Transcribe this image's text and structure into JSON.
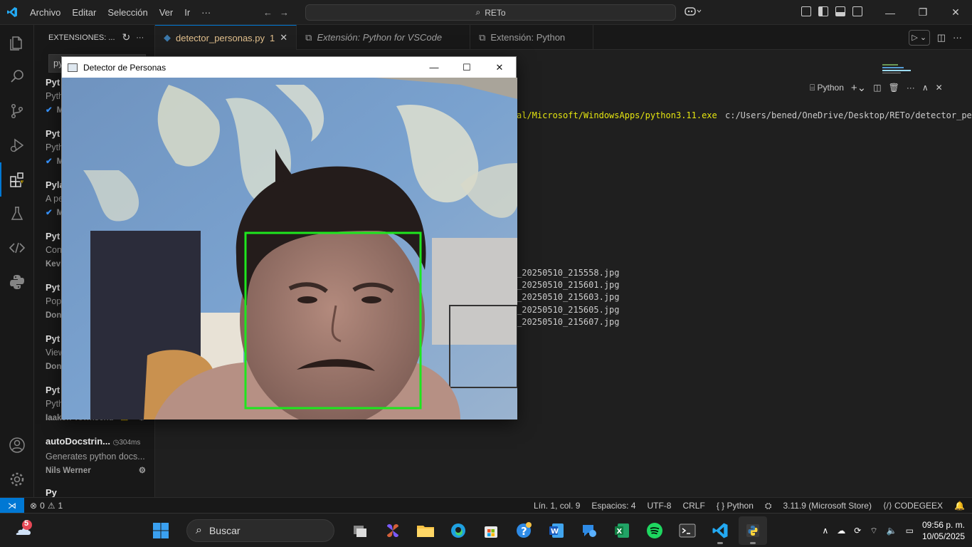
{
  "titlebar": {
    "menu": [
      "Archivo",
      "Editar",
      "Selección",
      "Ver",
      "Ir",
      "···"
    ],
    "search": "RETo"
  },
  "sidebar": {
    "title": "EXTENSIONES: ...",
    "search_value": "py",
    "extensions": [
      {
        "name": "Pyt",
        "desc": "Pyth",
        "publisher": "M"
      },
      {
        "name": "Pyt",
        "desc": "Pyth",
        "publisher": "M"
      },
      {
        "name": "Pyla",
        "desc": "A pe",
        "publisher": "M"
      },
      {
        "name": "Pyt",
        "desc": "Con",
        "publisher": "Kevi"
      },
      {
        "name": "Pyt",
        "desc": "Pop",
        "publisher": "Don"
      },
      {
        "name": "Pyt",
        "desc": "View",
        "publisher": "Don"
      },
      {
        "name": "Pyt",
        "desc": "Pyth",
        "publisher": "Iaakon Townsend"
      },
      {
        "name": "autoDocstrin...",
        "desc": "Generates python docs...",
        "publisher": "Nils Werner",
        "time": "304ms"
      },
      {
        "name": "Py",
        "desc": "",
        "publisher": ""
      }
    ]
  },
  "tabs": [
    {
      "label": "detector_personas.py",
      "badge": "1",
      "active": true
    },
    {
      "label": "Extensión: Python for VSCode",
      "active": false
    },
    {
      "label": "Extensión: Python",
      "active": false
    }
  ],
  "terminal": {
    "profile": "Python",
    "command_path": "al/Microsoft/WindowsApps/python3.11.exe",
    "command_arg": "c:/Users/bened/OneDrive/Desktop/RETo/detector_pers",
    "files": [
      "_20250510_215558.jpg",
      "_20250510_215601.jpg",
      "_20250510_215603.jpg",
      "_20250510_215605.jpg",
      "_20250510_215607.jpg"
    ]
  },
  "statusbar": {
    "problems": "0",
    "warnings": "1",
    "position": "Lín. 1, col. 9",
    "spaces": "Espacios: 4",
    "encoding": "UTF-8",
    "eol": "CRLF",
    "language": "Python",
    "interpreter": "3.11.9 (Microsoft Store)",
    "codegeex": "CODEGEEX"
  },
  "opencv_window": {
    "title": "Detector de Personas"
  },
  "taskbar": {
    "weather_badge": "5",
    "search": "Buscar",
    "time": "09:56 p. m.",
    "date": "10/05/2025"
  },
  "colors": {
    "accent": "#0078d4",
    "detection_box": "#1ee61e",
    "tab_modified": "#e2c08d"
  }
}
